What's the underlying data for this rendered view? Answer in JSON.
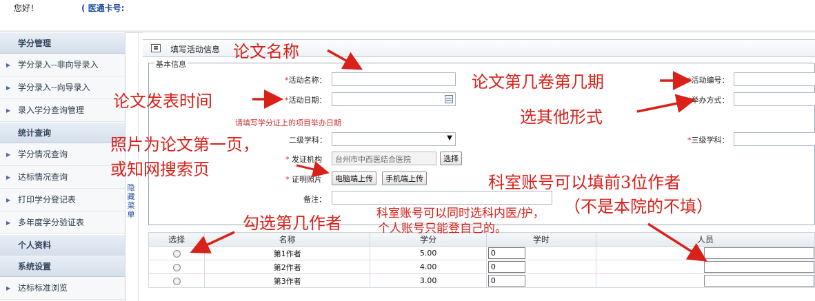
{
  "header": {
    "greeting": "您好！",
    "card_label": "( 医通卡号:"
  },
  "sidebar": {
    "hide_menu_label": "隐藏菜单",
    "groups": [
      {
        "title": "学分管理",
        "items": [
          "学分录入--非向导录入",
          "学分录入--向导录入",
          "录入学分查询管理"
        ]
      },
      {
        "title": "统计查询",
        "items": [
          "学分情况查询",
          "达标情况查询",
          "打印学分登记表",
          "多年度学分验证表"
        ]
      },
      {
        "title": "个人资料",
        "items": []
      },
      {
        "title": "系统设置",
        "items": [
          "达标标准浏览"
        ]
      }
    ]
  },
  "page": {
    "title": "填写活动信息",
    "section_legend": "基本信息"
  },
  "form": {
    "activity_name_label": "活动名称：",
    "activity_no_label": "活动编号：",
    "activity_date_label": "活动日期：",
    "hold_method_label": "举办方式：",
    "date_hint": "请填写学分证上的项目举办日期",
    "level2_label": "二级学科：",
    "level3_label": "三级学科：",
    "cert_org_label": "发证机构",
    "cert_org_value": "台州市中西医结合医院",
    "select_button": "选择",
    "photo_label": "证明照片",
    "upload_pc_button": "电脑端上传",
    "upload_mobile_button": "手机端上传",
    "remark_label": "备注：",
    "required_mark": "*"
  },
  "table": {
    "headers": [
      "选择",
      "名称",
      "学分",
      "学时",
      "人员"
    ],
    "rows": [
      {
        "name": "第1作者",
        "credit": "5.00",
        "hours": "0"
      },
      {
        "name": "第2作者",
        "credit": "4.00",
        "hours": "0"
      },
      {
        "name": "第3作者",
        "credit": "3.00",
        "hours": "0"
      }
    ]
  },
  "annotations": {
    "paper_name": "论文名称",
    "paper_volume": "论文第几卷第几期",
    "publish_time": "论文发表时间",
    "other_form": "选其他形式",
    "photo_line1": "照片为论文第一页，",
    "photo_line2": "或知网搜索页",
    "dept_account": "科室账号可以填前3位作者",
    "not_this_hospital": "（不是本院的不填）",
    "dept_select": "科室账号可以同时选科内医/护，",
    "personal_account": "个人账号只能登自己的。",
    "tick_author": "勾选第几作者"
  },
  "colors": {
    "annotation_red": "#d9211a",
    "link_blue": "#1f4fa0",
    "hint_red": "#cc3333"
  }
}
